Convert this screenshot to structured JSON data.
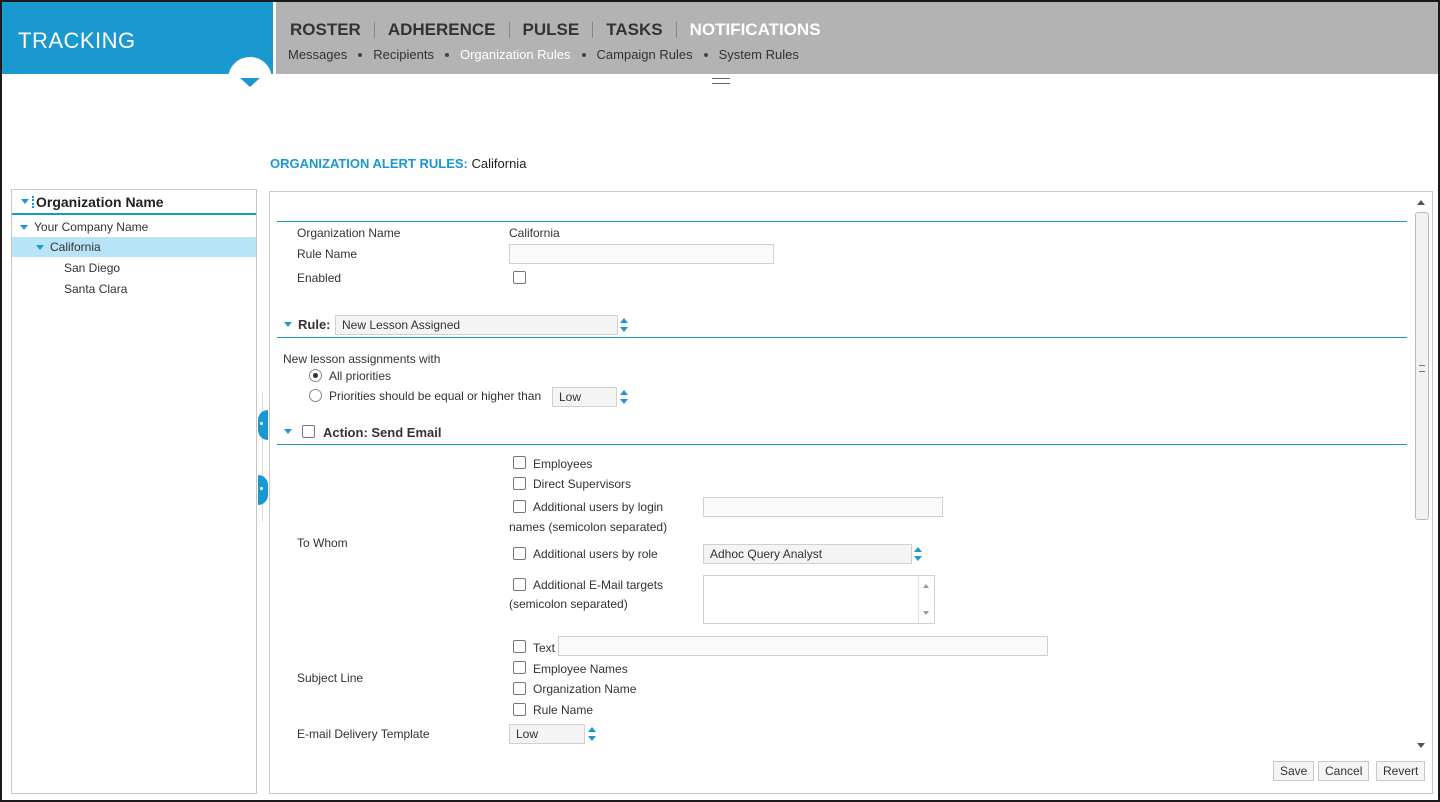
{
  "header": {
    "brand": "TRACKING",
    "main_nav": [
      {
        "label": "ROSTER",
        "active": false
      },
      {
        "label": "ADHERENCE",
        "active": false
      },
      {
        "label": "PULSE",
        "active": false
      },
      {
        "label": "TASKS",
        "active": false
      },
      {
        "label": "NOTIFICATIONS",
        "active": true
      }
    ],
    "sub_nav": [
      {
        "label": "Messages",
        "active": false
      },
      {
        "label": "Recipients",
        "active": false
      },
      {
        "label": "Organization Rules",
        "active": true
      },
      {
        "label": "Campaign Rules",
        "active": false
      },
      {
        "label": "System Rules",
        "active": false
      }
    ]
  },
  "page": {
    "title_label": "ORGANIZATION ALERT RULES:",
    "title_value": "California"
  },
  "tree": {
    "header": "Organization Name",
    "nodes": [
      {
        "label": "Your Company Name",
        "expanded": true,
        "selected": false
      },
      {
        "label": "California",
        "expanded": true,
        "selected": true
      },
      {
        "label": "San Diego",
        "expanded": false,
        "selected": false
      },
      {
        "label": "Santa Clara",
        "expanded": false,
        "selected": false
      }
    ]
  },
  "form": {
    "org_name_label": "Organization Name",
    "org_name_value": "California",
    "rule_name_label": "Rule Name",
    "rule_name_value": "",
    "enabled_label": "Enabled",
    "enabled_checked": false,
    "rule_label": "Rule:",
    "rule_value": "New Lesson Assigned",
    "lesson_intro": "New lesson assignments with",
    "radio_all": "All priorities",
    "radio_all_checked": true,
    "radio_priority": "Priorities should be equal or higher than",
    "radio_priority_checked": false,
    "priority_value": "Low",
    "action_label": "Action: Send Email",
    "action_checked": false,
    "to_whom_label": "To Whom",
    "to_whom": {
      "employees": "Employees",
      "direct_supervisors": "Direct Supervisors",
      "additional_login_line1": "Additional users by login",
      "additional_login_line2": "names (semicolon separated)",
      "additional_login_value": "",
      "additional_role": "Additional users by role",
      "role_value": "Adhoc Query Analyst",
      "additional_email_line1": "Additional E-Mail targets",
      "additional_email_line2": "(semicolon separated)",
      "additional_email_value": ""
    },
    "subject_line_label": "Subject Line",
    "subject": {
      "text": "Text",
      "text_value": "",
      "employee_names": "Employee Names",
      "organization_name": "Organization Name",
      "rule_name": "Rule Name"
    },
    "template_label": "E-mail Delivery Template",
    "template_value": "Low"
  },
  "buttons": {
    "save": "Save",
    "cancel": "Cancel",
    "revert": "Revert"
  },
  "colors": {
    "accent": "#1a98d0",
    "nav_bg": "#b3b3b3",
    "selected_row": "#b7e4f7"
  }
}
